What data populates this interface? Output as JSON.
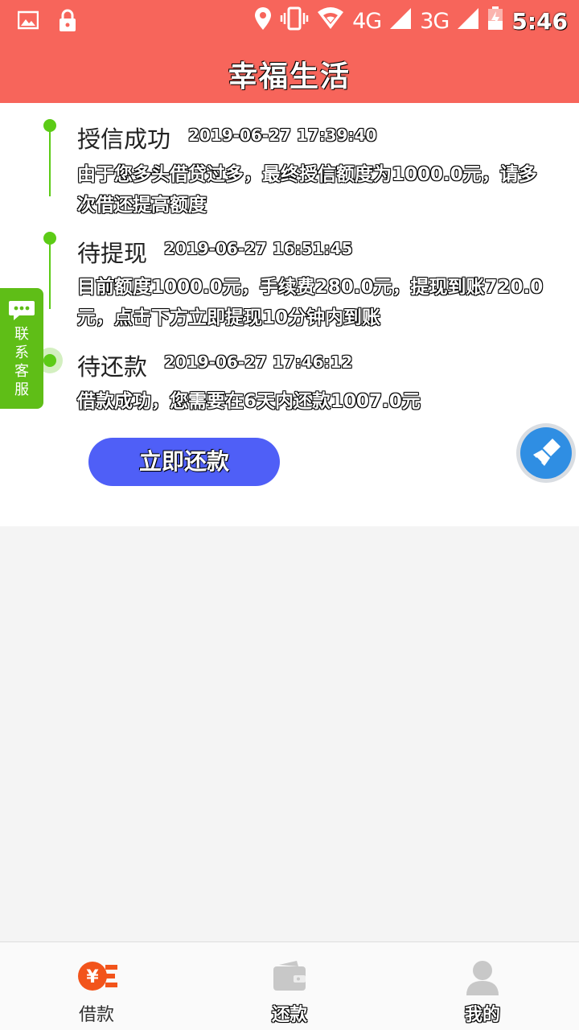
{
  "status_bar": {
    "time": "5:46",
    "network_1": "4G",
    "network_2": "3G",
    "icons": [
      "image-icon",
      "lock-icon",
      "location-icon",
      "vibrate-icon",
      "wifi-icon",
      "signal-icon",
      "signal-icon",
      "battery-charging-icon"
    ]
  },
  "header": {
    "title": "幸福生活"
  },
  "timeline": [
    {
      "title": "授信成功",
      "time": "2019-06-27 17:39:40",
      "desc": "由于您多头借贷过多，最终授信额度为1000.0元，请多次借还提高额度"
    },
    {
      "title": "待提现",
      "time": "2019-06-27 16:51:45",
      "desc": "目前额度1000.0元，手续费280.0元，提现到账720.0元，点击下方立即提现10分钟内到账"
    },
    {
      "title": "待还款",
      "time": "2019-06-27 17:46:12",
      "desc": "借款成功，您需要在6天内还款1007.0元"
    }
  ],
  "actions": {
    "repay_label": "立即还款"
  },
  "customer_service": {
    "chars": [
      "联",
      "系",
      "客",
      "服"
    ]
  },
  "tabbar": {
    "items": [
      {
        "label": "借款",
        "icon": "loan-yen-icon",
        "active": true
      },
      {
        "label": "还款",
        "icon": "wallet-icon",
        "active": false
      },
      {
        "label": "我的",
        "icon": "user-icon",
        "active": false
      }
    ]
  },
  "colors": {
    "header": "#f7655b",
    "timeline": "#5ccb16",
    "button": "#4f5ff7",
    "service_tab": "#5fbe17",
    "active_tab_icon": "#f2541b"
  }
}
